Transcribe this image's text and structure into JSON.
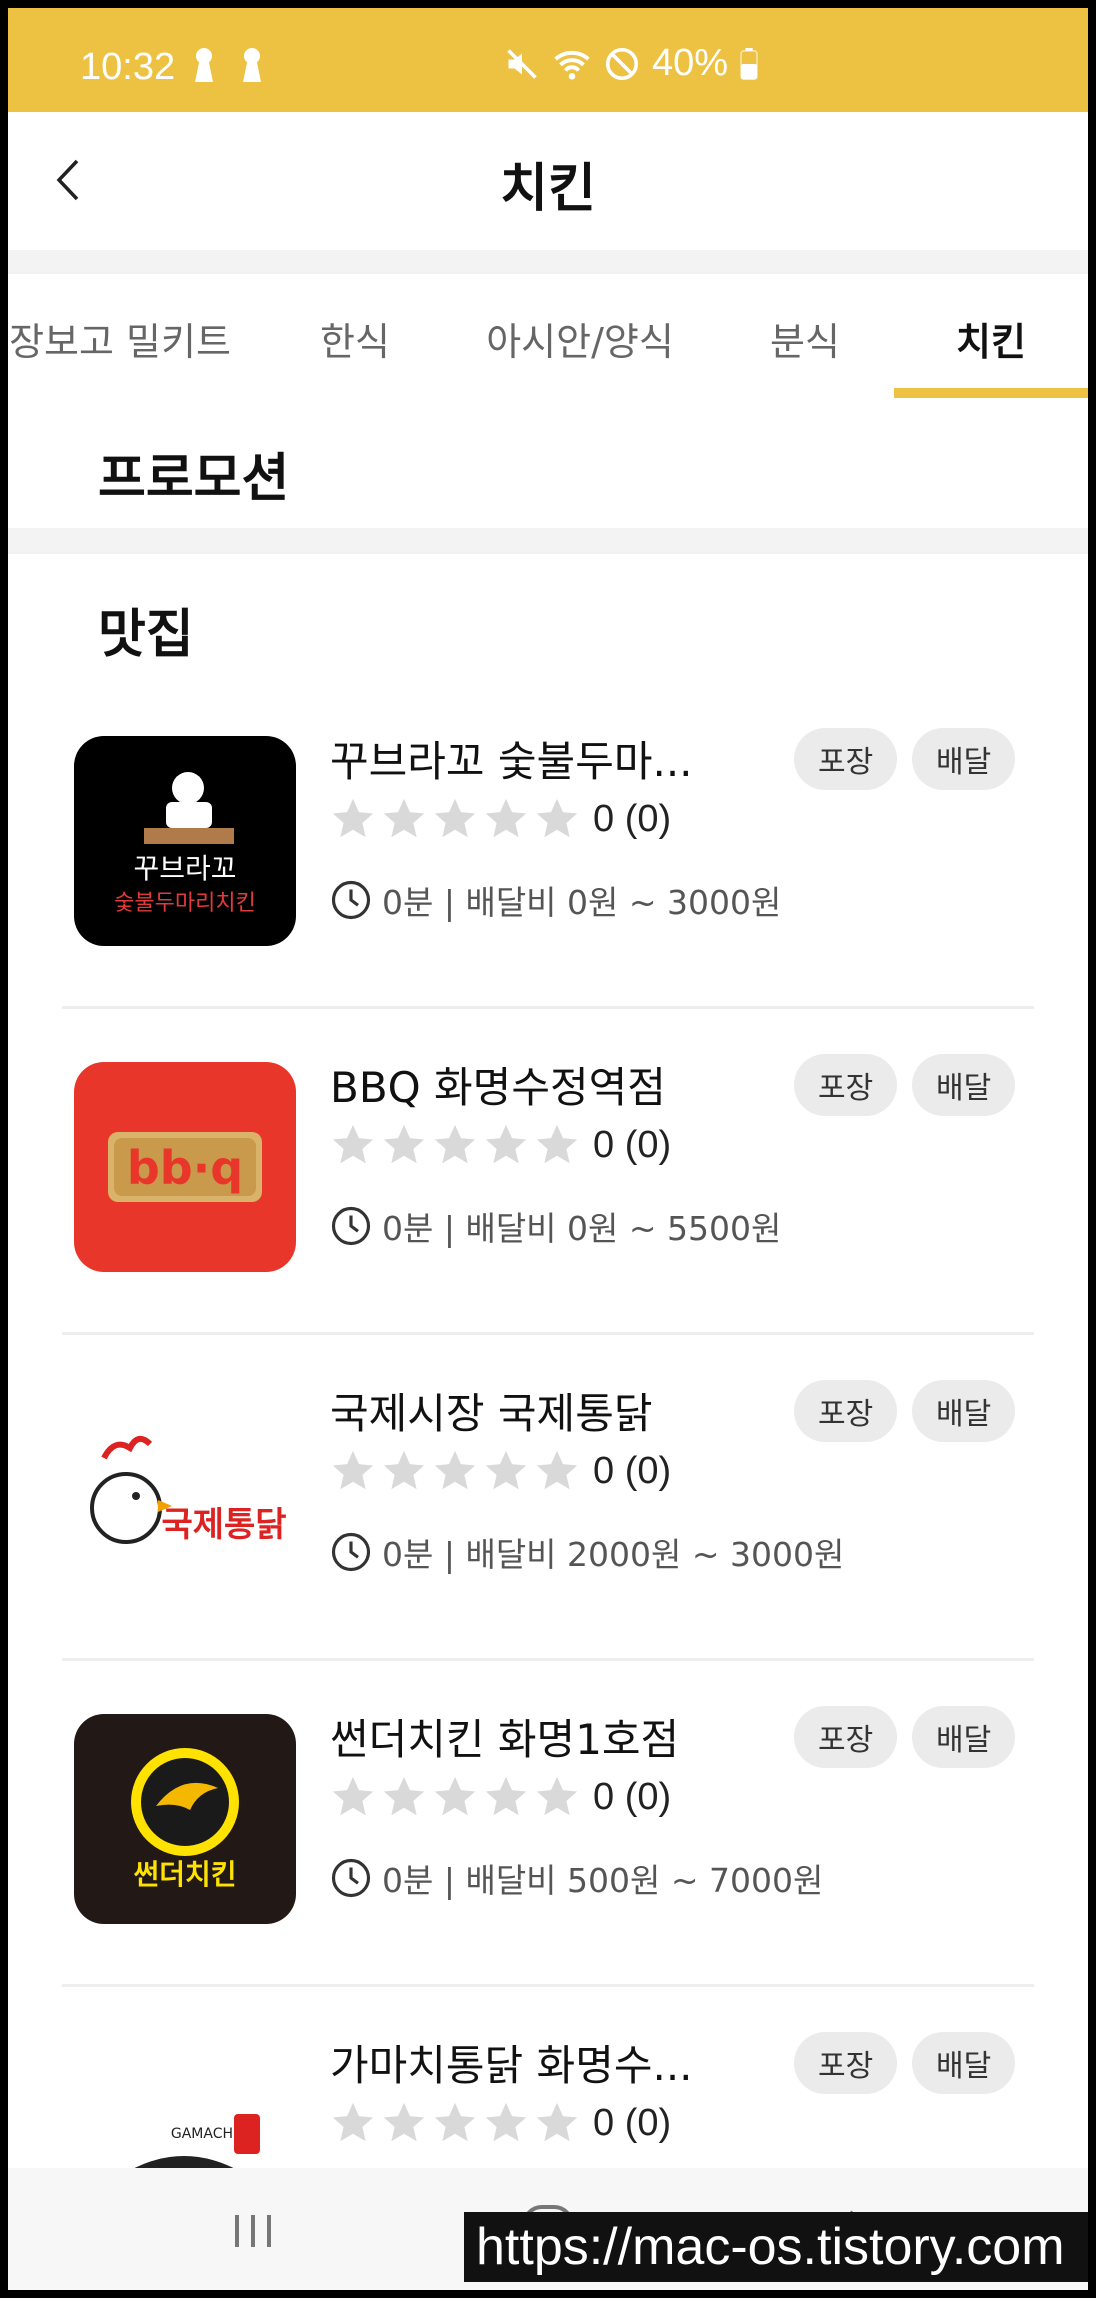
{
  "status_bar": {
    "time": "10:32",
    "battery": "40%"
  },
  "header": {
    "title": "치킨"
  },
  "tabs": [
    {
      "label": "장보고 밀키트"
    },
    {
      "label": "한식"
    },
    {
      "label": "아시안/양식"
    },
    {
      "label": "분식"
    },
    {
      "label": "치킨"
    }
  ],
  "sections": {
    "promotion": "프로모션",
    "matjip": "맛집"
  },
  "restaurants": [
    {
      "name": "꾸브라꼬 숯불두마...",
      "rating": "0 (0)",
      "info": "0분 | 배달비 0원 ~ 3000원",
      "badges": [
        "포장",
        "배달"
      ],
      "logo_text": "꾸브라꼬 숯불두마리치킨"
    },
    {
      "name": "BBQ 화명수정역점",
      "rating": "0 (0)",
      "info": "0분 | 배달비 0원 ~ 5500원",
      "badges": [
        "포장",
        "배달"
      ],
      "logo_text": "bb·q"
    },
    {
      "name": "국제시장 국제통닭",
      "rating": "0 (0)",
      "info": "0분 | 배달비 2000원 ~ 3000원",
      "badges": [
        "포장",
        "배달"
      ],
      "logo_text": "국제통닭"
    },
    {
      "name": "썬더치킨 화명1호점",
      "rating": "0 (0)",
      "info": "0분 | 배달비 500원 ~ 7000원",
      "badges": [
        "포장",
        "배달"
      ],
      "logo_text": "썬더치킨"
    },
    {
      "name": "가마치통닭 화명수...",
      "rating": "0 (0)",
      "info": "",
      "badges": [
        "포장",
        "배달"
      ],
      "logo_text": "GAMACHI"
    }
  ],
  "watermark": "https://mac-os.tistory.com",
  "colors": {
    "accent": "#EDC243",
    "bbq_red": "#E8372A",
    "badge_bg": "#EBEBEB"
  },
  "icons": [
    "back-arrow-icon",
    "star-icon",
    "clock-icon",
    "recent-apps-icon",
    "home-icon",
    "back-nav-icon"
  ]
}
